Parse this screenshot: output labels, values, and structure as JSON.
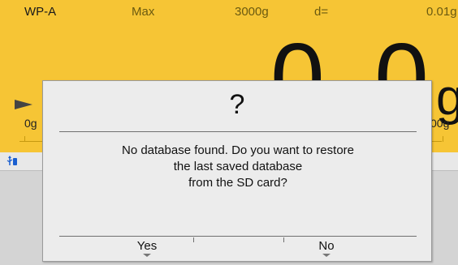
{
  "status_bar": {
    "model": "WP-A",
    "max_label": "Max",
    "capacity": "3000g",
    "d_label": "d=",
    "division": "0.01g"
  },
  "display": {
    "weight_digits": "0.0",
    "unit": "g",
    "scale_min": "0g",
    "scale_max_partial": "00g"
  },
  "dialog": {
    "title": "?",
    "message_lines": [
      "No database found. Do you want to restore",
      "the last saved database",
      "from the SD card?"
    ],
    "yes_label": "Yes",
    "no_label": "No"
  },
  "colors": {
    "accent_yellow": "#F6C535",
    "dialog_bg": "#ececec",
    "lower_bg": "#d4d4d4"
  },
  "icons": [
    "usb-icon",
    "arrow-left-icon",
    "chevron-down-icon"
  ]
}
